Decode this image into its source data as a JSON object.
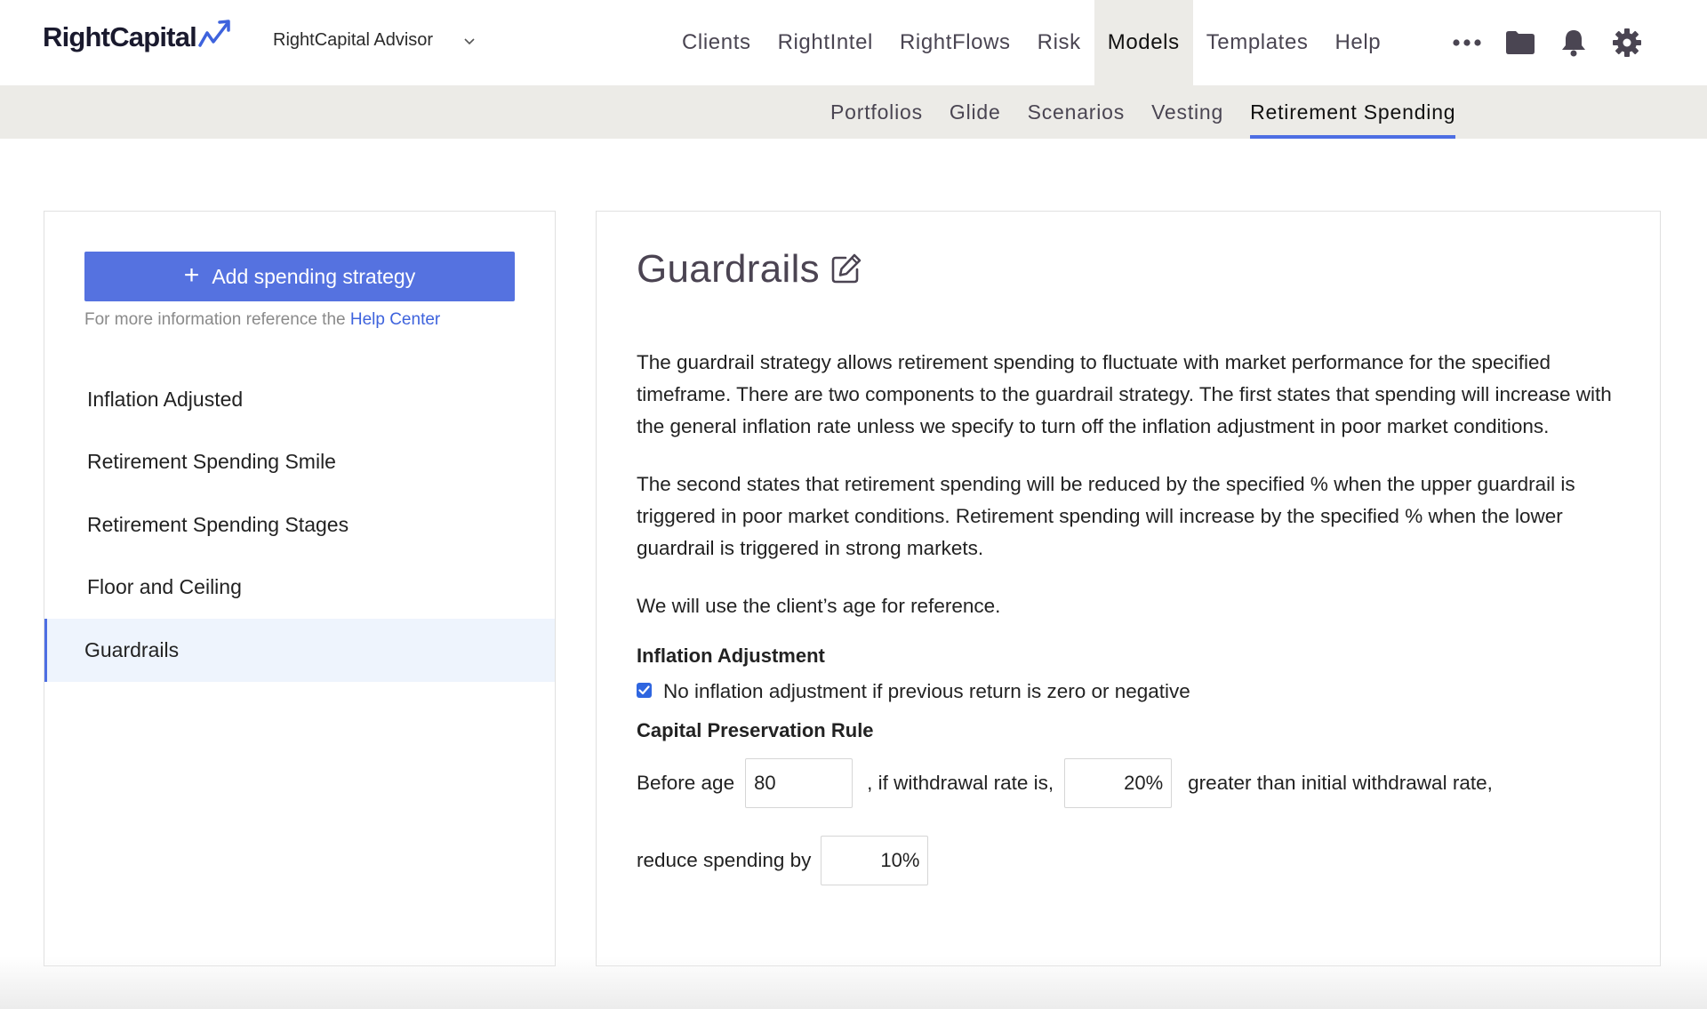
{
  "brand": {
    "logo_text": "RightCapital",
    "advisor_name": "RightCapital Advisor"
  },
  "main_nav": {
    "items": [
      {
        "label": "Clients",
        "active": false
      },
      {
        "label": "RightIntel",
        "active": false
      },
      {
        "label": "RightFlows",
        "active": false
      },
      {
        "label": "Risk",
        "active": false
      },
      {
        "label": "Models",
        "active": true
      },
      {
        "label": "Templates",
        "active": false
      },
      {
        "label": "Help",
        "active": false
      }
    ],
    "icons": [
      "more-icon",
      "folder-icon",
      "bell-icon",
      "gear-icon"
    ]
  },
  "sub_nav": {
    "items": [
      {
        "label": "Portfolios",
        "active": false
      },
      {
        "label": "Glide",
        "active": false
      },
      {
        "label": "Scenarios",
        "active": false
      },
      {
        "label": "Vesting",
        "active": false
      },
      {
        "label": "Retirement Spending",
        "active": true
      }
    ]
  },
  "sidebar": {
    "add_button_label": "Add spending strategy",
    "help_prefix": "For more information reference the",
    "help_link": "Help Center",
    "strategies": [
      {
        "label": "Inflation Adjusted",
        "active": false
      },
      {
        "label": "Retirement Spending Smile",
        "active": false
      },
      {
        "label": "Retirement Spending Stages",
        "active": false
      },
      {
        "label": "Floor and Ceiling",
        "active": false
      },
      {
        "label": "Guardrails",
        "active": true
      }
    ]
  },
  "detail": {
    "title": "Guardrails",
    "paragraphs": [
      "The guardrail strategy allows retirement spending to fluctuate with market performance for the specified timeframe. There are two components to the guardrail strategy. The first states that spending will increase with the general inflation rate unless we specify to turn off the inflation adjustment in poor market conditions.",
      "The second states that retirement spending will be reduced by the specified % when the upper guardrail is triggered in poor market conditions. Retirement spending will increase by the specified % when the lower guardrail is triggered in strong markets.",
      "We will use the client’s age for reference."
    ],
    "inflation": {
      "heading": "Inflation Adjustment",
      "checkbox_label": "No inflation adjustment if previous return is zero or negative",
      "checked": true
    },
    "capital_preservation": {
      "heading": "Capital Preservation Rule",
      "before_age_label": "Before age",
      "age_value": "80",
      "withdrawal_label": ", if withdrawal rate is,",
      "withdrawal_value": "20%",
      "greater_label": "greater than initial withdrawal rate,",
      "reduce_label": "reduce spending by",
      "reduce_value": "10%"
    }
  },
  "colors": {
    "accent": "#4d6ee3",
    "button": "#5572e0",
    "link": "#3e63dd",
    "nav_bg": "#ecebe7",
    "active_row_bg": "#eef4fd"
  }
}
